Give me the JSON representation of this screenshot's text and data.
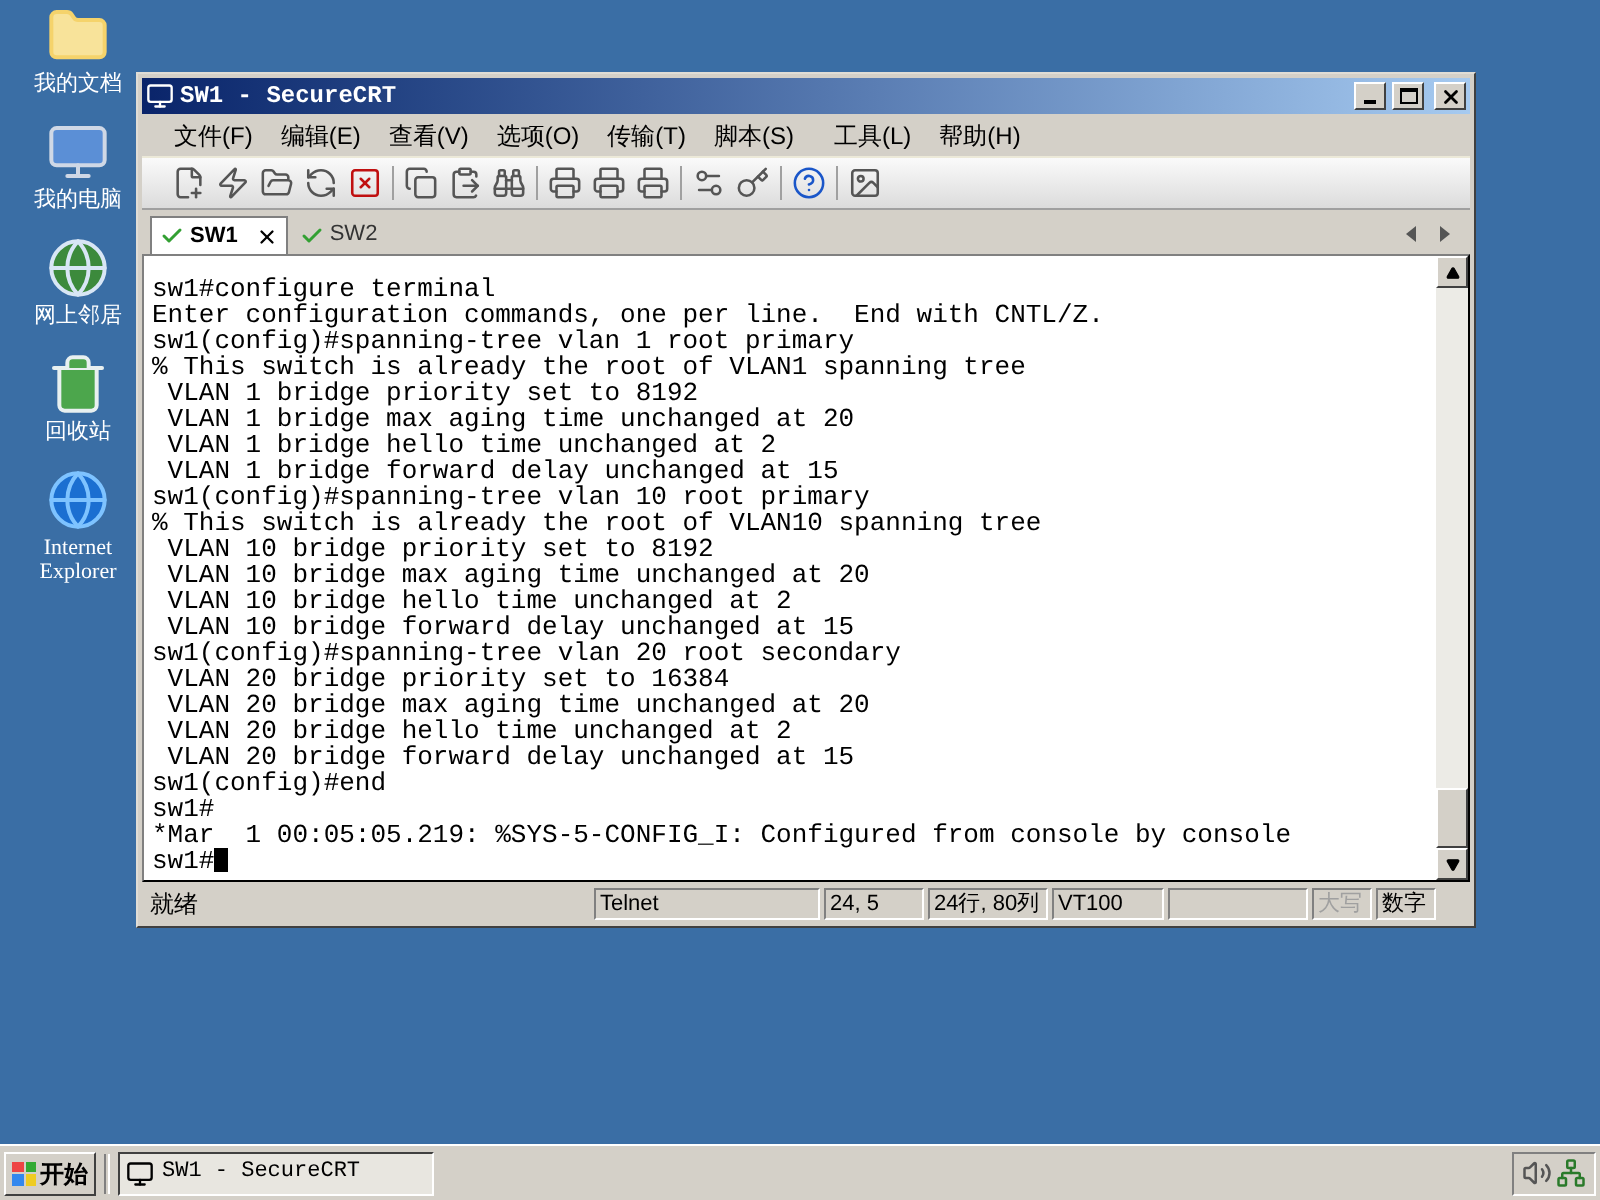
{
  "desktop_icons": [
    {
      "kind": "documents",
      "label": "我的文档"
    },
    {
      "kind": "computer",
      "label": "我的电脑"
    },
    {
      "kind": "network",
      "label": "网上邻居"
    },
    {
      "kind": "recycle",
      "label": "回收站"
    },
    {
      "kind": "browser",
      "label": "Internet Explorer"
    }
  ],
  "window": {
    "title": "SW1 - SecureCRT"
  },
  "menu": [
    "文件(F)",
    "编辑(E)",
    "查看(V)",
    "选项(O)",
    "传输(T)",
    "脚本(S)",
    "工具(L)",
    "帮助(H)"
  ],
  "tabs": [
    {
      "label": "SW1",
      "selected": true
    },
    {
      "label": "SW2",
      "selected": false
    }
  ],
  "terminal": {
    "lines": [
      "sw1#configure terminal",
      "Enter configuration commands, one per line.  End with CNTL/Z.",
      "sw1(config)#spanning-tree vlan 1 root primary",
      "% This switch is already the root of VLAN1 spanning tree",
      " VLAN 1 bridge priority set to 8192",
      " VLAN 1 bridge max aging time unchanged at 20",
      " VLAN 1 bridge hello time unchanged at 2",
      " VLAN 1 bridge forward delay unchanged at 15",
      "sw1(config)#spanning-tree vlan 10 root primary",
      "% This switch is already the root of VLAN10 spanning tree",
      " VLAN 10 bridge priority set to 8192",
      " VLAN 10 bridge max aging time unchanged at 20",
      " VLAN 10 bridge hello time unchanged at 2",
      " VLAN 10 bridge forward delay unchanged at 15",
      "sw1(config)#spanning-tree vlan 20 root secondary",
      " VLAN 20 bridge priority set to 16384",
      " VLAN 20 bridge max aging time unchanged at 20",
      " VLAN 20 bridge hello time unchanged at 2",
      " VLAN 20 bridge forward delay unchanged at 15",
      "sw1(config)#end",
      "sw1#",
      "*Mar  1 00:05:05.219: %SYS-5-CONFIG_I: Configured from console by console",
      "sw1#"
    ]
  },
  "status_bar": {
    "message": "就绪",
    "panels": [
      {
        "kind": "protocol",
        "text": "Telnet"
      },
      {
        "kind": "cursor",
        "text": "24,  5"
      },
      {
        "kind": "size",
        "text": "24行, 80列"
      },
      {
        "kind": "emulation",
        "text": "VT100"
      },
      {
        "kind": "blank"
      },
      {
        "kind": "indicator",
        "text": "大写",
        "disabled": true
      },
      {
        "kind": "indicator",
        "text": "数字",
        "disabled": false
      }
    ]
  },
  "taskbar": {
    "start": "开始",
    "tasks": [
      "SW1 - SecureCRT"
    ]
  }
}
